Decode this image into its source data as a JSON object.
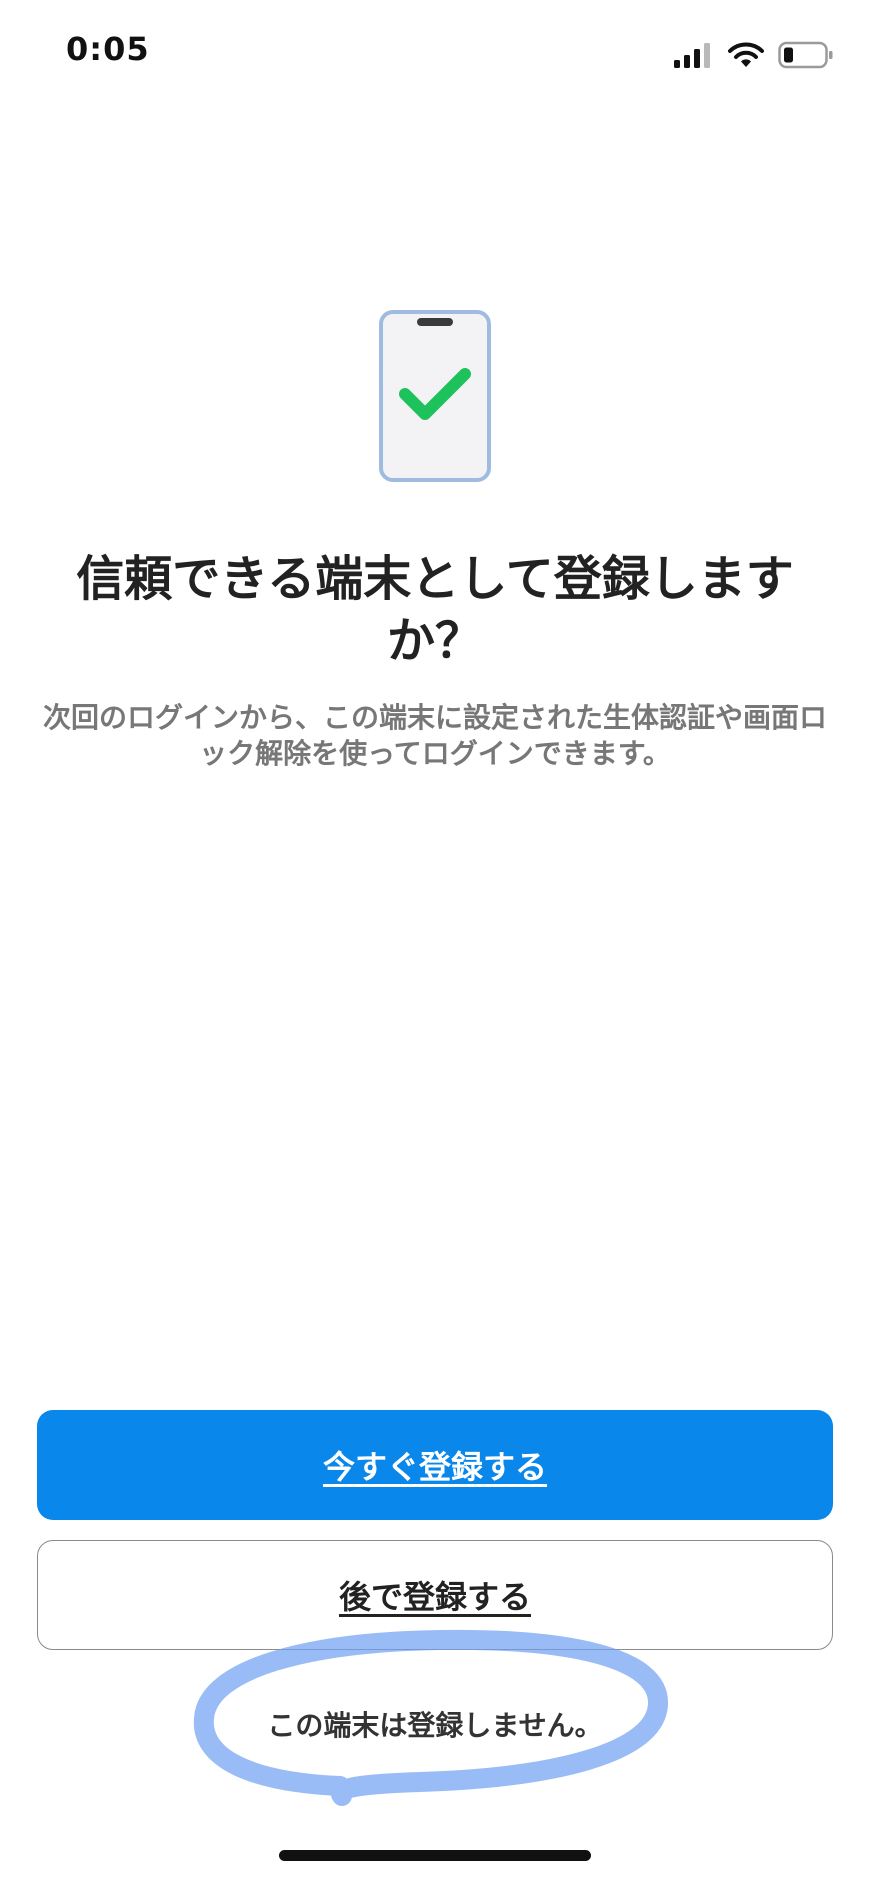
{
  "status_bar": {
    "time": "0:05",
    "icons": [
      "signal-bars-icon",
      "wifi-icon",
      "battery-low-icon"
    ]
  },
  "hero": {
    "icon": "smartphone-check-icon",
    "colors": {
      "device_fill": "#f3f3f5",
      "device_border": "#9fbce0",
      "check": "#1ec25c"
    }
  },
  "content": {
    "title": "信頼できる端末として登録しますか？",
    "description": "次回のログインから、この端末に設定された生体認証や画面ロック解除を使ってログインできます。"
  },
  "actions": {
    "register_now_label": "今すぐ登録する",
    "register_later_label": "後で登録する",
    "dont_register_label": "この端末は登録しません。"
  },
  "colors": {
    "primary": "#0a87eb",
    "annotation": "#6f9ff2"
  }
}
